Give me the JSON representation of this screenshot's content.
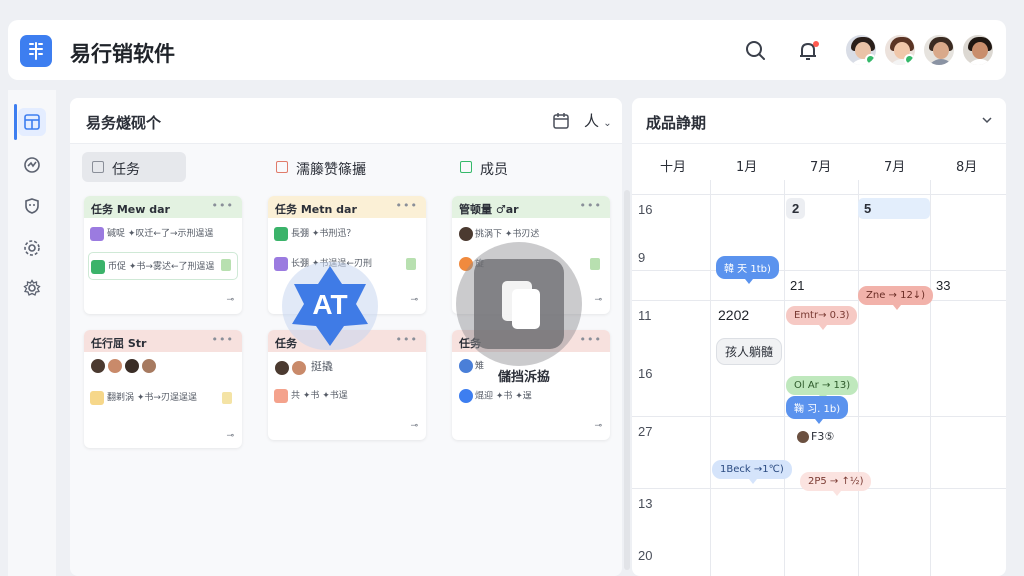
{
  "app": {
    "title": "易行销软件"
  },
  "header": {
    "search_icon": "search-icon",
    "bell_icon": "bell-icon"
  },
  "colors": {
    "accent": "#3d7ef0",
    "green": "#35b96a",
    "red_event": "#f6c9c4",
    "blue_event": "#5b93ee"
  },
  "sidebar": {
    "items": [
      "layout-icon",
      "analytics-icon",
      "shield-icon",
      "settings-icon",
      "gear-icon"
    ]
  },
  "board": {
    "title": "易务燧砚个",
    "toolbar": {
      "people_label": "人"
    },
    "columns": [
      {
        "title": "任务",
        "cards": [
          {
            "title": "任务 Mew dar",
            "rows": [
              "碱哫 ✦叹迁←了→示刑逞逞",
              "币促 ✦书→雾迖←了刑逞逞"
            ],
            "foot": "⊸"
          },
          {
            "title": "任行屈 Str",
            "rows": [
              "翻剃涡 ✦书→刃逞逞逞"
            ],
            "foot": "⊸"
          }
        ]
      },
      {
        "title": "濡籐赞篠攦",
        "cards": [
          {
            "title": "任务 Metn dar",
            "rows": [
              "長弸 ✦书刑迅？",
              "长弸 ✦书逞逞←刃刑"
            ],
            "foot": "⊸"
          },
          {
            "title": "任务",
            "rows": [
              "挺撬",
              "共 ✦书 ✦书逞"
            ],
            "foot": "⊸"
          }
        ]
      },
      {
        "title": "成员",
        "cards": [
          {
            "title": "管顿量 ♂ar",
            "rows": [
              "挑涡下 ✦书刃迖",
              "旋"
            ],
            "foot": "⊸"
          },
          {
            "title": "任务",
            "rows": [
              "雉",
              "焜迎 ✦书 ✦逞"
            ],
            "foot": "⊸"
          }
        ]
      }
    ]
  },
  "overlays": {
    "ai_label": "AT",
    "doc_caption": "儲挡泝拹"
  },
  "calendar": {
    "title": "成品諍期",
    "months": [
      "十月",
      "1月",
      "7月",
      "7月",
      "8月"
    ],
    "row_labels": [
      "16",
      "9",
      "11",
      "16",
      "27",
      "13",
      "20"
    ],
    "days": {
      "d2": "2",
      "d5": "5",
      "d21": "21",
      "d33": "33",
      "d2202": "2202"
    },
    "events": {
      "e1": "韓 天 1tb)",
      "e2": "Emtr→ 0.3)",
      "e3": "Zne → 12↓)",
      "e4": "孩人躺髓",
      "e5": "Ol Ar → 13)",
      "e6": "鞠 习. 1b)",
      "e7": "F3⑤",
      "e8": "1Beck →1℃)",
      "e9": "2P5 → ↑½)"
    }
  }
}
